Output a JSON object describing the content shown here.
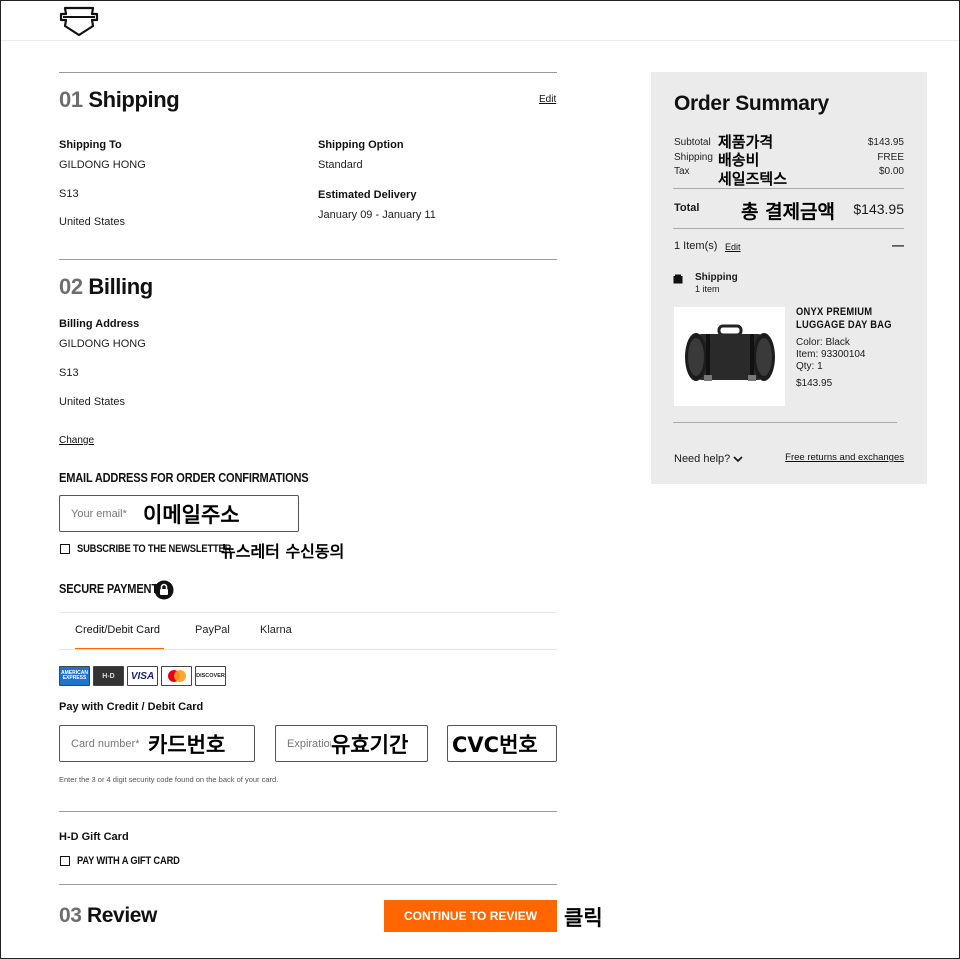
{
  "header": {
    "logo": "Harley-Davidson"
  },
  "shipping": {
    "num": "01",
    "title": "Shipping",
    "edit": "Edit",
    "to_label": "Shipping To",
    "name": "GILDONG HONG",
    "addr": "S13",
    "country": "United States",
    "option_label": "Shipping Option",
    "option_value": "Standard",
    "delivery_label": "Estimated Delivery",
    "delivery_value": "January 09 - January 11"
  },
  "billing": {
    "num": "02",
    "title": "Billing",
    "addr_label": "Billing Address",
    "name": "GILDONG HONG",
    "addr": "S13",
    "country": "United States",
    "change": "Change"
  },
  "email": {
    "heading": "EMAIL ADDRESS FOR ORDER CONFIRMATIONS",
    "placeholder": "Your email*",
    "annotation": "이메일주소",
    "newsletter": "SUBSCRIBE TO THE NEWSLETTER",
    "newsletter_annotation": "뉴스레터 수신동의"
  },
  "payment": {
    "heading": "SECURE PAYMENTS",
    "tabs": [
      "Credit/Debit Card",
      "PayPal",
      "Klarna"
    ],
    "cards": [
      "AMERICAN EXPRESS",
      "H-D",
      "VISA",
      "mastercard",
      "DISCOVER"
    ],
    "pay_with": "Pay with Credit / Debit Card",
    "card_placeholder": "Card number*",
    "card_annotation": "카드번호",
    "exp_placeholder": "Expiration*",
    "exp_annotation": "유효기간",
    "cvc_annotation": "CVC번호",
    "hint": "Enter the 3 or 4 digit security code found on the back of your card."
  },
  "gift": {
    "label": "H-D Gift Card",
    "checkbox": "PAY WITH A GIFT CARD"
  },
  "review": {
    "num": "03",
    "title": "Review",
    "button": "CONTINUE TO REVIEW",
    "annotation": "클릭"
  },
  "summary": {
    "title": "Order Summary",
    "subtotal_label": "Subtotal",
    "subtotal_annotation": "제품가격",
    "subtotal_value": "$143.95",
    "shipping_label": "Shipping",
    "shipping_annotation": "배송비",
    "shipping_value": "FREE",
    "tax_label": "Tax",
    "tax_annotation": "세일즈텍스",
    "tax_value": "$0.00",
    "total_label": "Total",
    "total_annotation": "총 결제금액",
    "total_value": "$143.95",
    "items": "1 Item(s)",
    "items_edit": "Edit",
    "collapse": "—",
    "ship_group_label": "Shipping",
    "ship_group_count": "1 item",
    "product": {
      "name_line1": "ONYX PREMIUM",
      "name_line2": "LUGGAGE DAY BAG",
      "color": "Color: Black",
      "item_no": "Item: 93300104",
      "qty": "Qty: 1",
      "price": "$143.95"
    },
    "need_help": "Need help?",
    "returns": "Free returns and exchanges"
  },
  "colors": {
    "accent": "#ff6600",
    "panel": "#ebebeb"
  }
}
